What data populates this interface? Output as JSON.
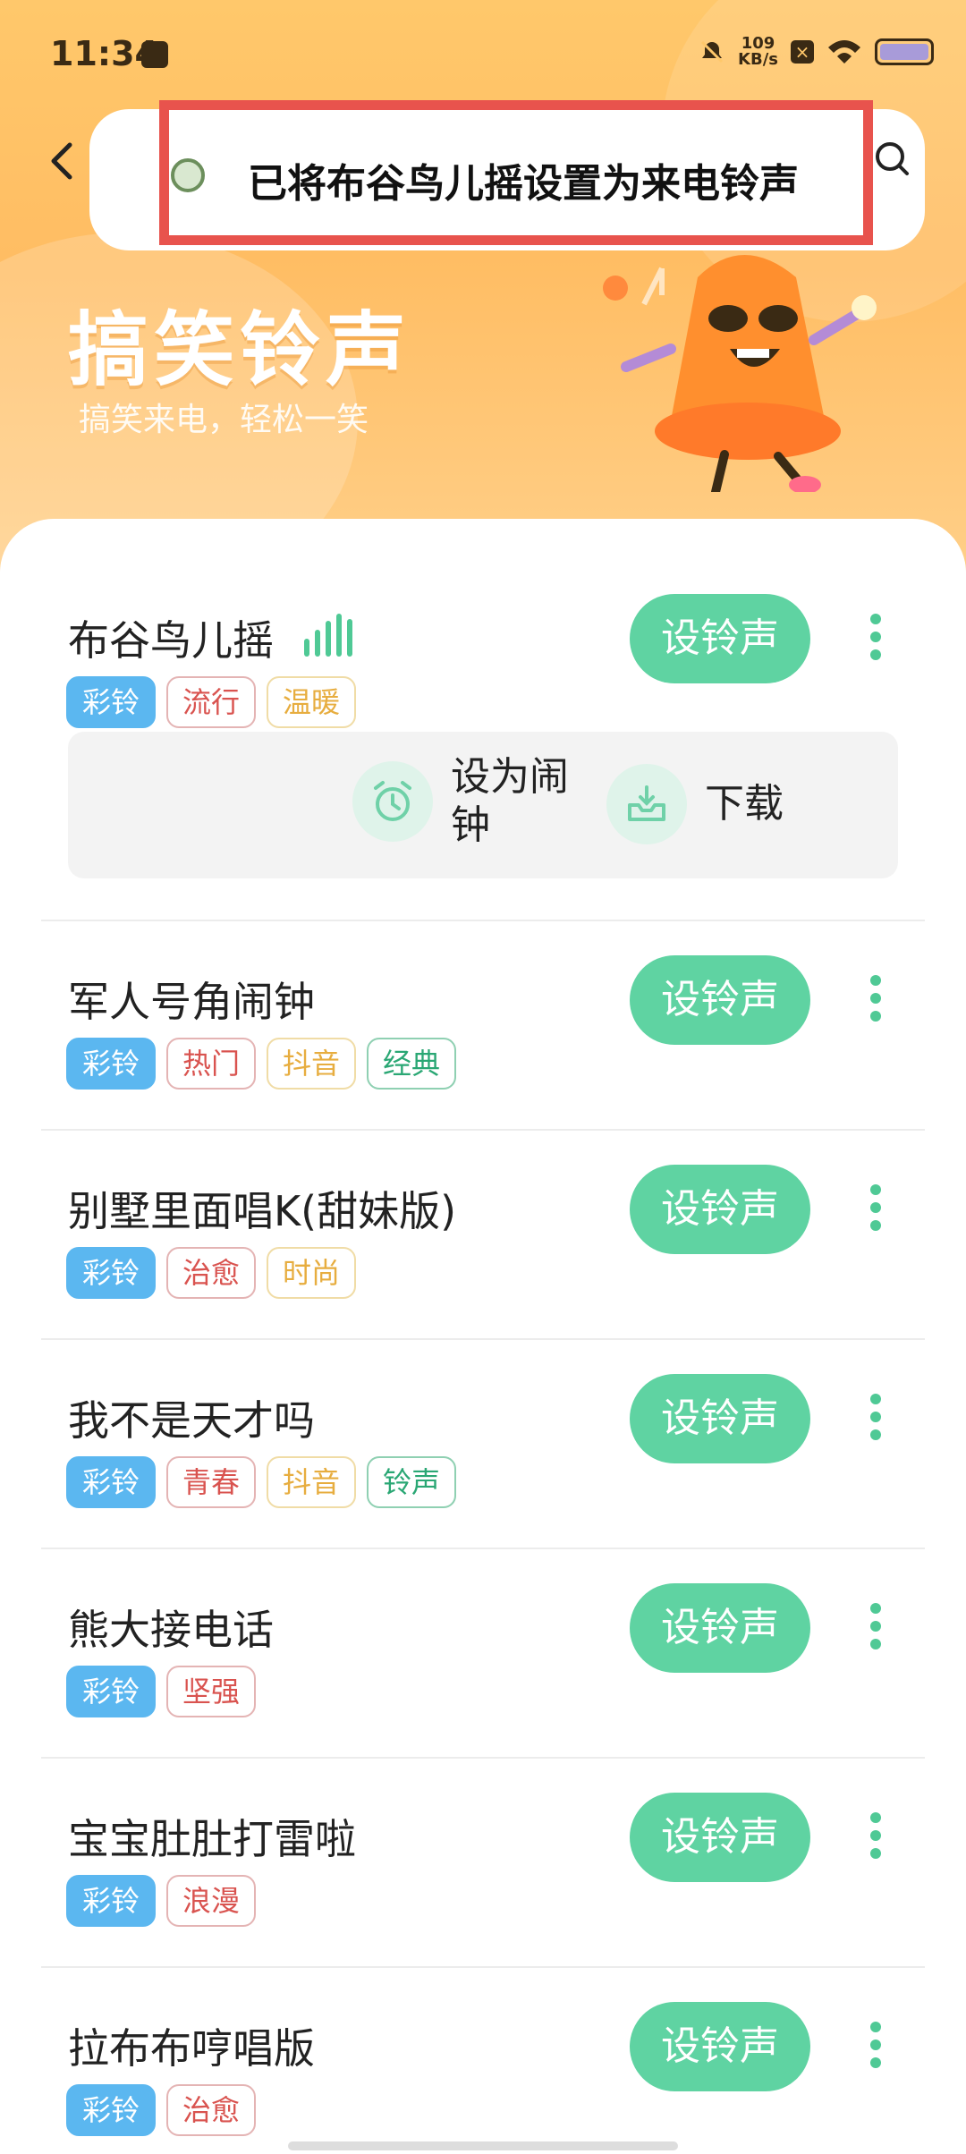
{
  "status_bar": {
    "time": "11:34",
    "net_speed_value": "109",
    "net_speed_unit": "KB/s",
    "icons": [
      "message-icon",
      "mute-icon",
      "close-box-icon",
      "wifi-icon",
      "battery-icon"
    ]
  },
  "header": {
    "back_icon": "chevron-left-icon",
    "search_icon": "search-icon"
  },
  "toast": {
    "message": "已将布谷鸟儿摇设置为来电铃声"
  },
  "hero": {
    "title": "搞笑铃声",
    "subtitle": "搞笑来电，轻松一笑"
  },
  "set_ringtone_label": "设铃声",
  "expanded_actions": {
    "alarm_label_line1": "设为闹",
    "alarm_label_line2": "钟",
    "download_label": "下载"
  },
  "songs": [
    {
      "title": "布谷鸟儿摇",
      "playing": true,
      "tags": [
        "彩铃",
        "流行",
        "温暖"
      ]
    },
    {
      "title": "军人号角闹钟",
      "tags": [
        "彩铃",
        "热门",
        "抖音",
        "经典"
      ]
    },
    {
      "title": "别墅里面唱K(甜妹版)",
      "tags": [
        "彩铃",
        "治愈",
        "时尚"
      ]
    },
    {
      "title": "我不是天才吗",
      "tags": [
        "彩铃",
        "青春",
        "抖音",
        "铃声"
      ]
    },
    {
      "title": "熊大接电话",
      "tags": [
        "彩铃",
        "坚强"
      ]
    },
    {
      "title": "宝宝肚肚打雷啦",
      "tags": [
        "彩铃",
        "浪漫"
      ]
    },
    {
      "title": "拉布布哼唱版",
      "tags": [
        "彩铃",
        "治愈"
      ]
    }
  ],
  "colors": {
    "accent_green": "#5fd3a2",
    "tag_blue": "#5bb7f0",
    "toast_border": "#e8534d",
    "hero_orange": "#ffc86b"
  }
}
